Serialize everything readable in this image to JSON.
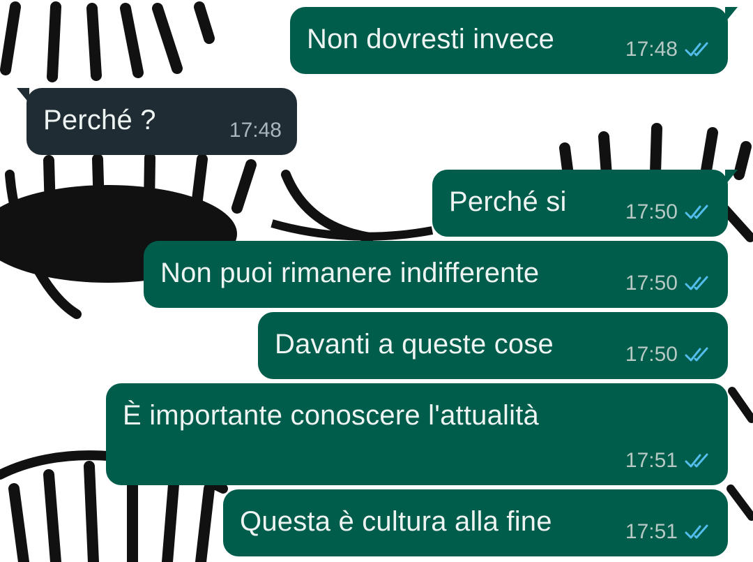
{
  "conversation": {
    "messages": [
      {
        "text": "Non dovresti invece",
        "time": "17:48",
        "direction": "outgoing",
        "status": "read"
      },
      {
        "text": "Perché ?",
        "time": "17:48",
        "direction": "incoming"
      },
      {
        "text": "Perché si",
        "time": "17:50",
        "direction": "outgoing",
        "status": "read"
      },
      {
        "text": "Non puoi rimanere indifferente",
        "time": "17:50",
        "direction": "outgoing",
        "status": "read"
      },
      {
        "text": "Davanti a queste cose",
        "time": "17:50",
        "direction": "outgoing",
        "status": "read"
      },
      {
        "text": "È importante conoscere l'attualità",
        "time": "17:51",
        "direction": "outgoing",
        "status": "read"
      },
      {
        "text": "Questa è cultura alla fine",
        "time": "17:51",
        "direction": "outgoing",
        "status": "read"
      }
    ]
  },
  "colors": {
    "outgoing_bubble": "#005c4b",
    "incoming_bubble": "#1f2c34",
    "read_tick": "#53bdeb",
    "wallpaper_ink": "#111111",
    "wallpaper_bg": "#ffffff"
  },
  "icons": {
    "read_status": "double-check-icon"
  }
}
